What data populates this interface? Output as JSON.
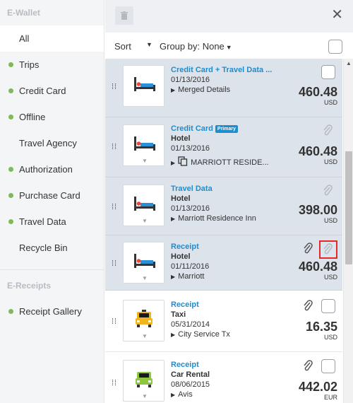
{
  "sidebar": {
    "ewallet_header": "E-Wallet",
    "items": [
      {
        "label": "All",
        "dot": false
      },
      {
        "label": "Trips",
        "dot": true
      },
      {
        "label": "Credit Card",
        "dot": true
      },
      {
        "label": "Offline",
        "dot": true
      },
      {
        "label": "Travel Agency",
        "dot": false
      },
      {
        "label": "Authorization",
        "dot": true
      },
      {
        "label": "Purchase Card",
        "dot": true
      },
      {
        "label": "Travel Data",
        "dot": true
      },
      {
        "label": "Recycle Bin",
        "dot": false
      }
    ],
    "ereceipts_header": "E-Receipts",
    "receipt_gallery": "Receipt Gallery"
  },
  "toolbar": {
    "sort_label": "Sort",
    "groupby_label": "Group by: None"
  },
  "rows": [
    {
      "title": "Credit Card + Travel Data ...",
      "date": "01/13/2016",
      "detail": "Merged Details",
      "amount": "460.48",
      "currency": "USD"
    },
    {
      "title": "Credit Card",
      "badge": "Primary",
      "type": "Hotel",
      "date": "01/13/2016",
      "detail": "MARRIOTT RESIDE...",
      "amount": "460.48",
      "currency": "USD"
    },
    {
      "title": "Travel Data",
      "type": "Hotel",
      "date": "01/13/2016",
      "detail": "Marriott Residence Inn",
      "amount": "398.00",
      "currency": "USD"
    },
    {
      "title": "Receipt",
      "type": "Hotel",
      "date": "01/11/2016",
      "detail": "Marriott",
      "amount": "460.48",
      "currency": "USD"
    },
    {
      "title": "Receipt",
      "type": "Taxi",
      "date": "05/31/2014",
      "detail": "City Service Tx",
      "amount": "16.35",
      "currency": "USD"
    },
    {
      "title": "Receipt",
      "type": "Car Rental",
      "date": "08/06/2015",
      "detail": "Avis",
      "amount": "442.02",
      "currency": "EUR"
    }
  ],
  "icons": {
    "hotel": "bed-icon",
    "taxi": "taxi-icon",
    "car": "car-icon",
    "attach": "paperclip-icon",
    "trash": "trash-icon",
    "close": "close-icon"
  },
  "colors": {
    "accent": "#1f8dcd",
    "status_dot": "#7fb95b",
    "selected_row": "#dde3ea",
    "highlight": "#e3272b"
  }
}
